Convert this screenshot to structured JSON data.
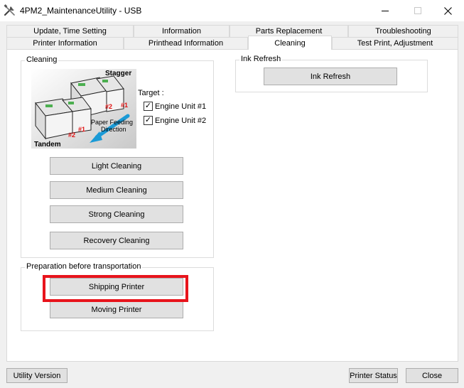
{
  "window": {
    "title": "4PM2_MaintenanceUtility - USB",
    "minimize_label": "—",
    "maximize_label": "☐",
    "close_label": "✕"
  },
  "tabs": {
    "row1": [
      "Update, Time Setting",
      "Information",
      "Parts Replacement",
      "Troubleshooting"
    ],
    "row2": [
      "Printer Information",
      "Printhead Information",
      "Cleaning",
      "Test Print, Adjustment"
    ],
    "active": "Cleaning"
  },
  "cleaning": {
    "group_title": "Cleaning",
    "illustration": {
      "stagger_label": "Stagger",
      "tandem_label": "Tandem",
      "unit1_label": "#1",
      "unit2_label": "#2",
      "paper_feed_label_line1": "Paper Feeding",
      "paper_feed_label_line2": "Direction"
    },
    "target_label": "Target :",
    "targets": [
      {
        "label": "Engine Unit #1",
        "checked": true
      },
      {
        "label": "Engine Unit #2",
        "checked": true
      }
    ],
    "buttons": [
      "Light Cleaning",
      "Medium Cleaning",
      "Strong Cleaning",
      "Recovery Cleaning"
    ]
  },
  "transport": {
    "group_title": "Preparation before transportation",
    "shipping_button": "Shipping Printer",
    "moving_button": "Moving Printer",
    "highlight_color": "#e8141c"
  },
  "ink_refresh": {
    "group_title": "Ink Refresh",
    "button": "Ink Refresh"
  },
  "footer": {
    "utility_version": "Utility Version",
    "printer_status": "Printer Status",
    "close": "Close"
  },
  "check_mark": "✓"
}
